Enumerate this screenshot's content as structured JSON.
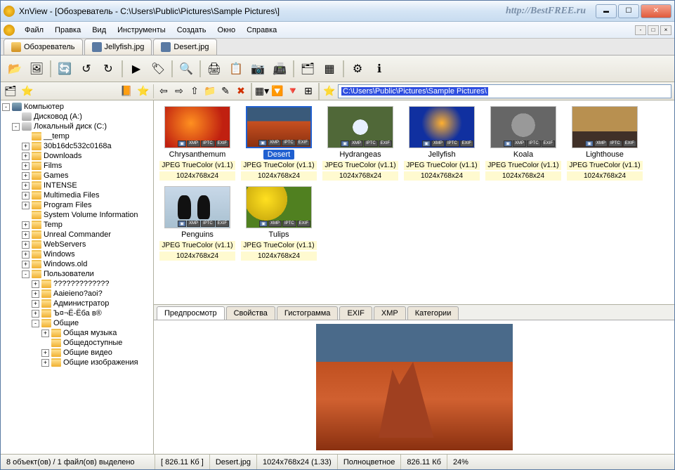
{
  "window": {
    "title": "XnView - [Обозреватель - C:\\Users\\Public\\Pictures\\Sample Pictures\\]",
    "watermark": "http://BestFREE.ru"
  },
  "menu": {
    "items": [
      "Файл",
      "Правка",
      "Вид",
      "Инструменты",
      "Создать",
      "Окно",
      "Справка"
    ]
  },
  "tabs": [
    {
      "label": "Обозреватель",
      "icon": "browser"
    },
    {
      "label": "Jellyfish.jpg",
      "icon": "img"
    },
    {
      "label": "Desert.jpg",
      "icon": "img"
    }
  ],
  "addressbar": {
    "path": "C:\\Users\\Public\\Pictures\\Sample Pictures\\"
  },
  "tree": {
    "root": "Компьютер",
    "items": [
      {
        "label": "Дисковод (A:)",
        "indent": 1,
        "icon": "drive",
        "toggle": ""
      },
      {
        "label": "Локальный диск (C:)",
        "indent": 1,
        "icon": "drive",
        "toggle": "-"
      },
      {
        "label": "__temp",
        "indent": 2,
        "icon": "folder",
        "toggle": ""
      },
      {
        "label": "30b16dc532c0168a",
        "indent": 2,
        "icon": "folder",
        "toggle": "+"
      },
      {
        "label": "Downloads",
        "indent": 2,
        "icon": "folder",
        "toggle": "+"
      },
      {
        "label": "Films",
        "indent": 2,
        "icon": "folder",
        "toggle": "+"
      },
      {
        "label": "Games",
        "indent": 2,
        "icon": "folder",
        "toggle": "+"
      },
      {
        "label": "INTENSE",
        "indent": 2,
        "icon": "folder",
        "toggle": "+"
      },
      {
        "label": "Multimedia Files",
        "indent": 2,
        "icon": "folder",
        "toggle": "+"
      },
      {
        "label": "Program Files",
        "indent": 2,
        "icon": "folder",
        "toggle": "+"
      },
      {
        "label": "System Volume Information",
        "indent": 2,
        "icon": "folder",
        "toggle": ""
      },
      {
        "label": "Temp",
        "indent": 2,
        "icon": "folder",
        "toggle": "+"
      },
      {
        "label": "Unreal Commander",
        "indent": 2,
        "icon": "folder",
        "toggle": "+"
      },
      {
        "label": "WebServers",
        "indent": 2,
        "icon": "folder",
        "toggle": "+"
      },
      {
        "label": "Windows",
        "indent": 2,
        "icon": "folder",
        "toggle": "+"
      },
      {
        "label": "Windows.old",
        "indent": 2,
        "icon": "folder",
        "toggle": "+"
      },
      {
        "label": "Пользователи",
        "indent": 2,
        "icon": "folder",
        "toggle": "-"
      },
      {
        "label": "?????????????",
        "indent": 3,
        "icon": "folder",
        "toggle": "+"
      },
      {
        "label": "Aaieieno?aoi?",
        "indent": 3,
        "icon": "folder",
        "toggle": "+"
      },
      {
        "label": "Администратор",
        "indent": 3,
        "icon": "folder",
        "toggle": "+"
      },
      {
        "label": "Ъ¤¬Ё-Ёба в®",
        "indent": 3,
        "icon": "folder",
        "toggle": "+"
      },
      {
        "label": "Общие",
        "indent": 3,
        "icon": "folder",
        "toggle": "-"
      },
      {
        "label": "Общая музыка",
        "indent": 4,
        "icon": "folder",
        "toggle": "+"
      },
      {
        "label": "Общедоступные",
        "indent": 4,
        "icon": "folder",
        "toggle": ""
      },
      {
        "label": "Общие видео",
        "indent": 4,
        "icon": "folder",
        "toggle": "+"
      },
      {
        "label": "Общие изображения",
        "indent": 4,
        "icon": "folder",
        "toggle": "+"
      }
    ]
  },
  "thumbs": [
    {
      "name": "Chrysanthemum",
      "format": "JPEG TrueColor (v1.1)",
      "dim": "1024x768x24",
      "cls": "tc-chrys",
      "selected": false
    },
    {
      "name": "Desert",
      "format": "JPEG TrueColor (v1.1)",
      "dim": "1024x768x24",
      "cls": "tc-desert",
      "selected": true
    },
    {
      "name": "Hydrangeas",
      "format": "JPEG TrueColor (v1.1)",
      "dim": "1024x768x24",
      "cls": "tc-hydra",
      "selected": false
    },
    {
      "name": "Jellyfish",
      "format": "JPEG TrueColor (v1.1)",
      "dim": "1024x768x24",
      "cls": "tc-jelly",
      "selected": false
    },
    {
      "name": "Koala",
      "format": "JPEG TrueColor (v1.1)",
      "dim": "1024x768x24",
      "cls": "tc-koala",
      "selected": false
    },
    {
      "name": "Lighthouse",
      "format": "JPEG TrueColor (v1.1)",
      "dim": "1024x768x24",
      "cls": "tc-light",
      "selected": false
    },
    {
      "name": "Penguins",
      "format": "JPEG TrueColor (v1.1)",
      "dim": "1024x768x24",
      "cls": "tc-peng",
      "selected": false
    },
    {
      "name": "Tulips",
      "format": "JPEG TrueColor (v1.1)",
      "dim": "1024x768x24",
      "cls": "tc-tulip",
      "selected": false
    }
  ],
  "badges": {
    "cam": "📷",
    "xmp": "XMP",
    "iptc": "IPTC",
    "exif": "EXIF"
  },
  "bottomTabs": [
    "Предпросмотр",
    "Свойства",
    "Гистограмма",
    "EXIF",
    "XMP",
    "Категории"
  ],
  "status": {
    "count": "8 объект(ов) / 1 файл(ов) выделено",
    "size": "[ 826.11 Кб ]",
    "filename": "Desert.jpg",
    "dim": "1024x768x24 (1.33)",
    "color": "Полноцветное",
    "filesize": "826.11 Кб",
    "zoom": "24%"
  }
}
